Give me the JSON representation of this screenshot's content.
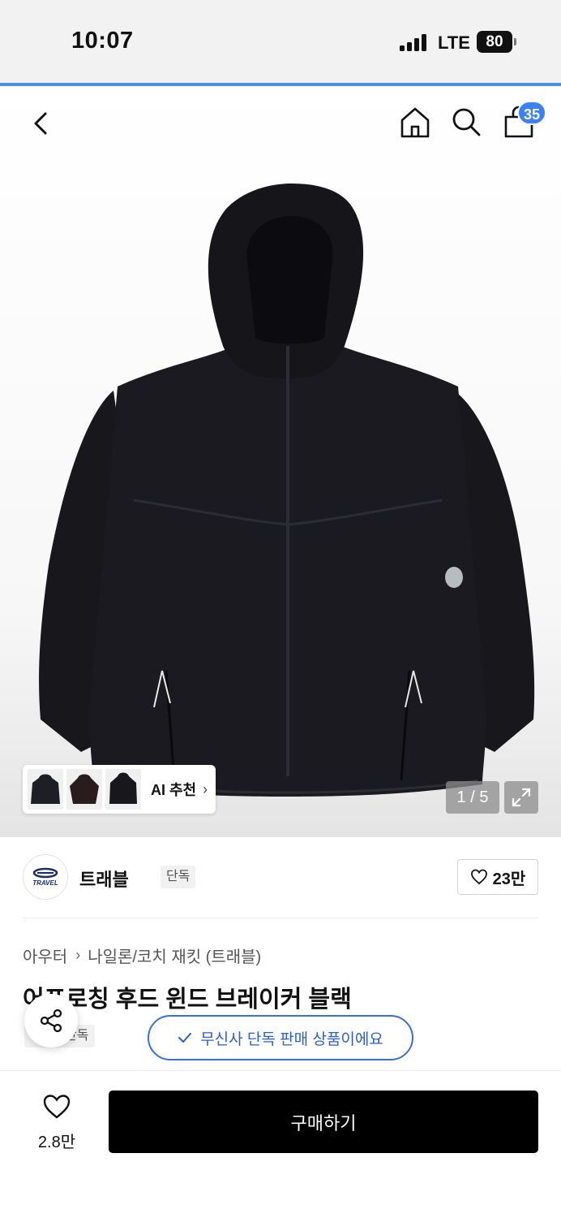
{
  "status_bar": {
    "time": "10:07",
    "network": "LTE",
    "battery": "80"
  },
  "header": {
    "cart_count": "35"
  },
  "gallery": {
    "ai_recommend_label": "AI 추천",
    "page_indicator": "1 / 5"
  },
  "brand": {
    "logo_text": "TRAVEL",
    "name": "트래블",
    "exclusive_tag": "단독",
    "like_count": "23만"
  },
  "product": {
    "breadcrumb": [
      "아우터",
      "나일론/코치 재킷 (트래블)"
    ],
    "title": "어프로칭 후드 윈드 브레이커 블랙",
    "badge": "단독",
    "verify_text": "무신사 단독 판매 상품이에요"
  },
  "bottom_bar": {
    "wish_count": "2.8만",
    "buy_label": "구매하기"
  },
  "colors": {
    "accent_blue": "#3a6fd8",
    "badge_blue": "#3b82f6",
    "buy_black": "#000000"
  }
}
